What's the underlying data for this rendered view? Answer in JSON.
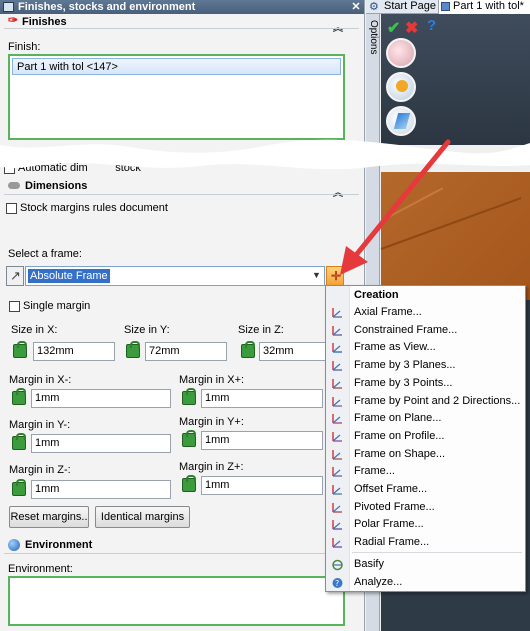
{
  "window": {
    "title": "Finishes, stocks and environment",
    "close": "✕"
  },
  "finishes": {
    "header": "Finishes",
    "finish_label": "Finish:",
    "finish_item": "Part 1 with tol <147>"
  },
  "auto_stock_label": "Automatic dim         stock",
  "dimensions": {
    "header": "Dimensions",
    "stock_rules_label": "Stock margins rules document",
    "select_frame_label": "Select a frame:",
    "frame_value": "Absolute Frame",
    "single_margin_label": "Single margin",
    "size_x_label": "Size in X:",
    "size_x_value": "132mm",
    "size_y_label": "Size in Y:",
    "size_y_value": "72mm",
    "size_z_label": "Size in Z:",
    "size_z_value": "32mm",
    "margin_xm_label": "Margin in X-:",
    "margin_xm_value": "1mm",
    "margin_xp_label": "Margin in X+:",
    "margin_xp_value": "1mm",
    "margin_ym_label": "Margin in Y-:",
    "margin_ym_value": "1mm",
    "margin_yp_label": "Margin in Y+:",
    "margin_yp_value": "1mm",
    "margin_zm_label": "Margin in Z-:",
    "margin_zm_value": "1mm",
    "margin_zp_label": "Margin in Z+:",
    "margin_zp_value": "1mm",
    "reset_button": "Reset  margins..",
    "identical_button": "Identical margins"
  },
  "environment": {
    "header": "Environment",
    "env_label": "Environment:"
  },
  "right": {
    "tab_start": "Start Page",
    "tab_part": "Part 1 with tol*",
    "options_label": "Options"
  },
  "menu": {
    "header": "Creation",
    "items": [
      "Axial Frame...",
      "Constrained Frame...",
      "Frame as View...",
      "Frame by 3 Planes...",
      "Frame by 3 Points...",
      "Frame by Point and 2 Directions...",
      "Frame on Plane...",
      "Frame on Profile...",
      "Frame on Shape...",
      "Frame...",
      "Offset Frame...",
      "Pivoted Frame...",
      "Polar Frame...",
      "Radial Frame..."
    ],
    "extra_items": [
      "Basify",
      "Analyze..."
    ]
  },
  "colors": {
    "accent_red": "#e5393b",
    "list_border": "#59b35c",
    "select_highlight": "#3470c8"
  }
}
